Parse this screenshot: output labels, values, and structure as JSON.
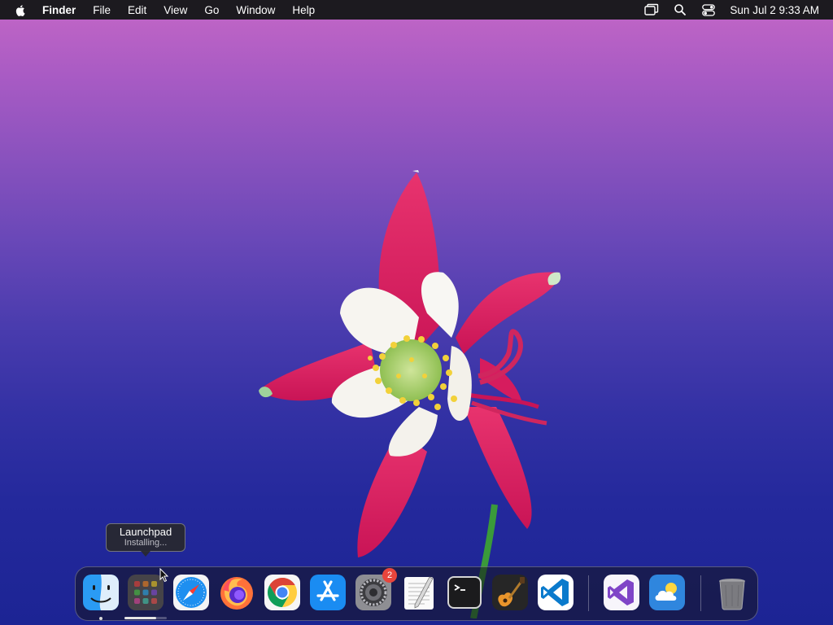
{
  "menubar": {
    "apple_icon": "apple-logo-icon",
    "app_name": "Finder",
    "menus": [
      "File",
      "Edit",
      "View",
      "Go",
      "Window",
      "Help"
    ],
    "status_icons": [
      "screen-mirroring-icon",
      "spotlight-search-icon",
      "control-center-icon"
    ],
    "clock": "Sun Jul 2  9:33 AM"
  },
  "tooltip": {
    "title": "Launchpad",
    "subtitle": "Installing..."
  },
  "dock": {
    "apps": [
      {
        "name": "Finder",
        "icon": "finder-icon",
        "running": true
      },
      {
        "name": "Launchpad",
        "icon": "launchpad-icon",
        "installing_progress": 0.75
      },
      {
        "name": "Safari",
        "icon": "safari-icon"
      },
      {
        "name": "Firefox",
        "icon": "firefox-icon"
      },
      {
        "name": "Google Chrome",
        "icon": "chrome-icon"
      },
      {
        "name": "App Store",
        "icon": "app-store-icon"
      },
      {
        "name": "System Settings",
        "icon": "system-settings-icon",
        "badge": "2"
      },
      {
        "name": "TextEdit",
        "icon": "textedit-icon"
      },
      {
        "name": "Terminal",
        "icon": "terminal-icon"
      },
      {
        "name": "GarageBand",
        "icon": "garageband-icon"
      },
      {
        "name": "Visual Studio Code",
        "icon": "vscode-icon"
      },
      {
        "name": "Visual Studio",
        "icon": "visual-studio-icon"
      },
      {
        "name": "Weather",
        "icon": "weather-icon"
      },
      {
        "name": "Trash",
        "icon": "trash-icon"
      }
    ]
  },
  "colors": {
    "menubar_bg": "#1c1a1f",
    "badge": "#e8453c",
    "wallpaper_top": "#c467c6",
    "wallpaper_bottom": "#1c2494"
  }
}
